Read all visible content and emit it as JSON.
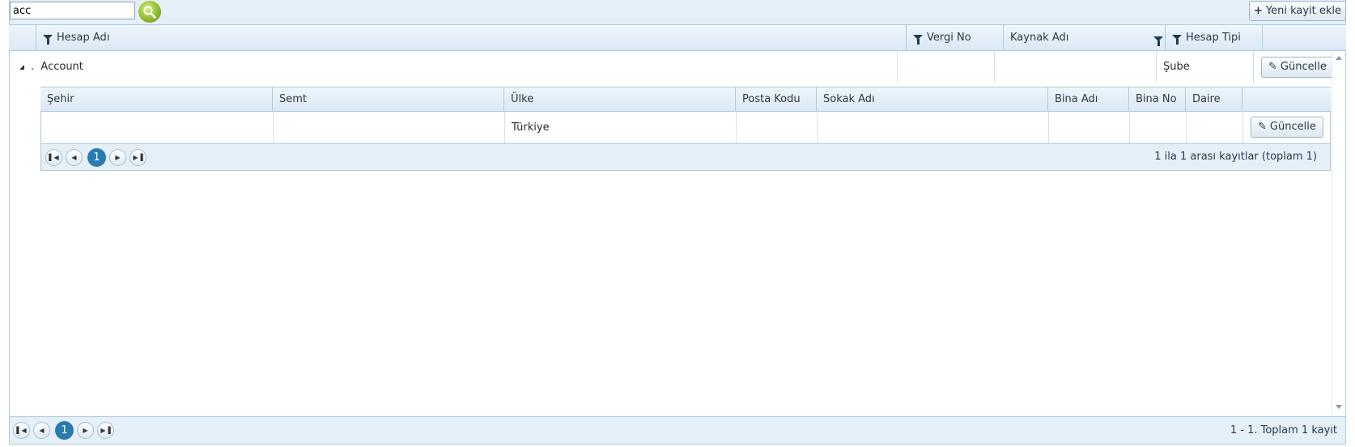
{
  "toolbar": {
    "search_value": "acc",
    "add_button_label": "Yeni kayit ekle"
  },
  "grid": {
    "columns": [
      "Hesap Adı",
      "Vergi No",
      "Kaynak Adı",
      "Hesap Tipi"
    ],
    "rows": [
      {
        "hesap_adi": "Account",
        "vergi_no": "",
        "kaynak_adi": "",
        "hesap_tipi": "Şube",
        "update_label": "Güncelle"
      }
    ],
    "pager": {
      "current_page": "1",
      "info": "1 - 1. Toplam 1 kayıt"
    }
  },
  "detail": {
    "columns": [
      "Şehir",
      "Semt",
      "Ülke",
      "Posta Kodu",
      "Sokak Adı",
      "Bina Adı",
      "Bina No",
      "Daire"
    ],
    "rows": [
      {
        "sehir": "",
        "semt": "",
        "ulke": "Türkiye",
        "posta_kodu": "",
        "sokak_adi": "",
        "bina_adi": "",
        "bina_no": "",
        "daire": "",
        "update_label": "Güncelle"
      }
    ],
    "pager": {
      "current_page": "1",
      "info": "1 ila 1 arası kayıtlar (toplam 1)"
    }
  },
  "icons": {
    "search": "search-icon",
    "filter": "filter-icon",
    "pencil": "pencil-icon",
    "expand": "collapse-triangle-icon",
    "pager_first": "first-page-icon",
    "pager_prev": "prev-page-icon",
    "pager_next": "next-page-icon",
    "pager_last": "last-page-icon"
  },
  "colors": {
    "header_bg": "#dbe8f4",
    "border": "#aecbe0",
    "current_page": "#2a7bb0",
    "search_button": "#9bc43a"
  }
}
